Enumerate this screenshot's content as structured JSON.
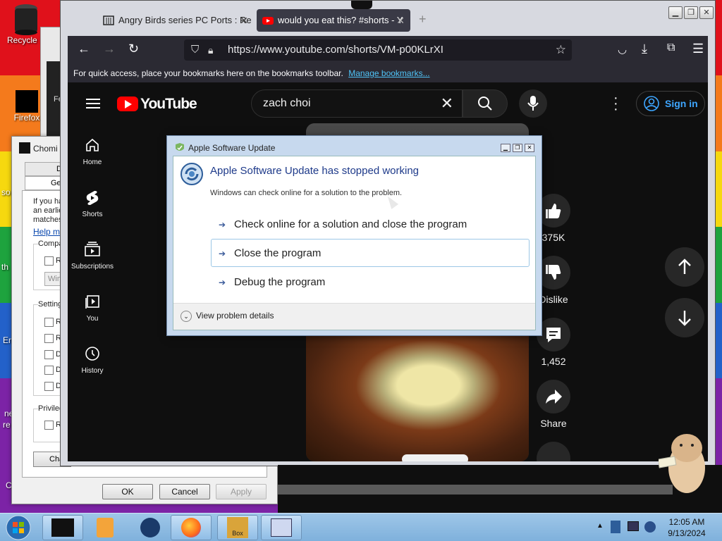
{
  "desktop": {
    "icons": [
      {
        "name": "recycle-bin",
        "label": "Recycle B"
      },
      {
        "name": "firefox",
        "label": "Firefox"
      }
    ],
    "edge_fragments": [
      "so",
      "th",
      "En",
      "ne",
      "re",
      "C"
    ]
  },
  "properties_window": {
    "title": "Chomi",
    "tabs": [
      "Deta",
      "Genera"
    ],
    "text_lines": [
      "If you ha",
      "an earlie",
      "matches"
    ],
    "help_link": "Help m",
    "compat_group": "Compa",
    "compat_checkbox": "R",
    "compat_select": "Win",
    "settings_group": "Setting",
    "settings_items": [
      "R",
      "R",
      "D",
      "D",
      "D"
    ],
    "privilege_group": "Privileg",
    "privilege_item": "R",
    "change_button": "Cha",
    "ok": "OK",
    "cancel": "Cancel",
    "apply": "Apply"
  },
  "browser": {
    "tabs": [
      {
        "title": "Angry Birds series PC Ports : Re",
        "active": false
      },
      {
        "title": "would you eat this? #shorts - Y",
        "active": true
      }
    ],
    "new_tab": "+",
    "url": "https://www.youtube.com/shorts/VM-p00KLrXI",
    "bookmarks_text": "For quick access, place your bookmarks here on the bookmarks toolbar.",
    "bookmarks_link": "Manage bookmarks...",
    "back_window_text": "Fe"
  },
  "youtube": {
    "logo": "YouTube",
    "search_value": "zach choi",
    "sign_in": "Sign in",
    "nav": [
      {
        "label": "Home",
        "icon": "home-icon"
      },
      {
        "label": "Shorts",
        "icon": "shorts-icon"
      },
      {
        "label": "Subscriptions",
        "icon": "subscriptions-icon"
      },
      {
        "label": "You",
        "icon": "you-icon"
      },
      {
        "label": "History",
        "icon": "history-icon"
      }
    ],
    "actions": [
      {
        "label": "375K",
        "icon": "like-icon"
      },
      {
        "label": "Dislike",
        "icon": "dislike-icon"
      },
      {
        "label": "1,452",
        "icon": "comment-icon"
      },
      {
        "label": "Share",
        "icon": "share-icon"
      }
    ]
  },
  "dialog": {
    "title": "Apple Software Update",
    "heading": "Apple Software Update has stopped working",
    "subtext": "Windows can check online for a solution to the problem.",
    "options": [
      "Check online for a solution and close the program",
      "Close the program",
      "Debug the program"
    ],
    "details": "View problem details"
  },
  "taskbar": {
    "time": "12:05 AM",
    "date": "9/13/2024",
    "apps": [
      "black-window-icon",
      "media-player-icon",
      "earth-icon",
      "firefox-icon",
      "box-game-icon",
      "chart-app-icon"
    ],
    "box_label": "Box"
  },
  "colors": {
    "dialog_heading": "#1e3a8a",
    "youtube_red": "#ff0000",
    "link_blue": "#3ea6ff"
  }
}
